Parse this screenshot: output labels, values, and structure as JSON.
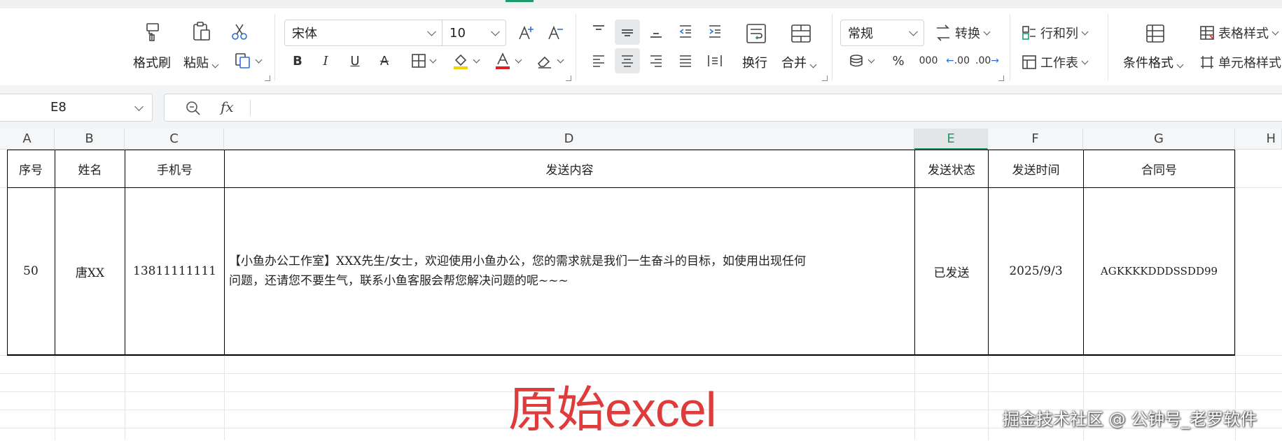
{
  "ribbon": {
    "format_painter": "格式刷",
    "paste": "粘贴",
    "font_name": "宋体",
    "font_size": "10",
    "wrap_text": "换行",
    "merge": "合并",
    "number_format": "常规",
    "convert": "转换",
    "rows_cols": "行和列",
    "worksheet": "工作表",
    "conditional_format": "条件格式",
    "table_style": "表格样式",
    "cell_style": "单元格样式",
    "percent": "%",
    "thousands": "000",
    "dec_increase": ".00",
    "dec_decrease": ".00"
  },
  "formula_bar": {
    "cell_ref": "E8",
    "fx_label": "fx"
  },
  "columns": [
    "A",
    "B",
    "C",
    "D",
    "E",
    "F",
    "G",
    "H"
  ],
  "selected_column": "E",
  "table": {
    "headers": [
      "序号",
      "姓名",
      "手机号",
      "发送内容",
      "发送状态",
      "发送时间",
      "合同号"
    ],
    "row": {
      "index": "50",
      "name": "唐XX",
      "phone": "13811111111",
      "content_line1": "【小鱼办公工作室】XXX先生/女士，欢迎使用小鱼办公，您的需求就是我们一生奋斗的目标，如使用出现任何",
      "content_line2": "问题，还请您不要生气，联系小鱼客服会帮您解决问题的呢~~~",
      "status": "已发送",
      "send_time": "2025/9/3",
      "contract": "AGKKKKDDDSSDD99"
    }
  },
  "overlay": {
    "title": "原始excel",
    "title_color": "#e03b3b",
    "watermark": "掘金技术社区 @ 公钟号_老罗软件"
  },
  "colors": {
    "accent": "#1e9b6b",
    "font_color_underline": "#e02020",
    "highlight_underline": "#f2d500"
  }
}
